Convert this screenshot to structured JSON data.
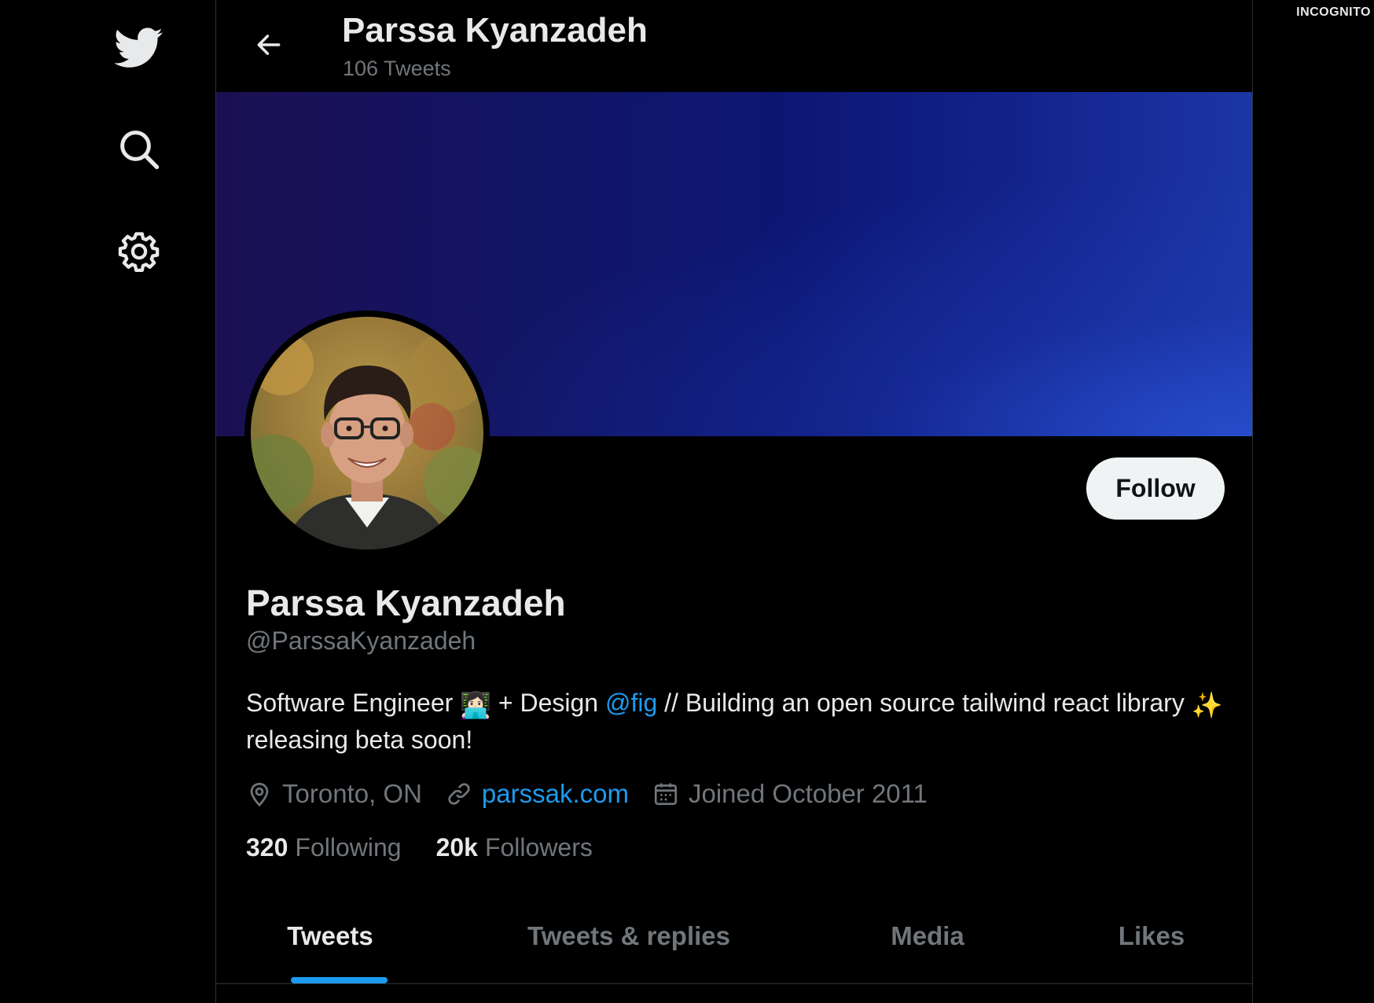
{
  "nav": {
    "items": [
      {
        "icon": "twitter-bird-icon"
      },
      {
        "icon": "search-icon"
      },
      {
        "icon": "gear-icon"
      }
    ]
  },
  "header": {
    "name": "Parssa Kyanzadeh",
    "tweet_count": "106 Tweets"
  },
  "profile": {
    "name": "Parssa Kyanzadeh",
    "handle": "@ParssaKyanzadeh",
    "follow_label": "Follow",
    "bio": {
      "part1": "Software Engineer ",
      "emoji1": "👩🏻‍💻",
      "part2": " + Design ",
      "mention": "@fig",
      "part3": " // Building an open source tailwind react library ",
      "emoji2": "✨",
      "part4": " releasing beta soon!"
    },
    "location": "Toronto, ON",
    "website": "parssak.com",
    "joined": "Joined October 2011",
    "following_count": "320",
    "following_label": "Following",
    "followers_count": "20k",
    "followers_label": "Followers"
  },
  "tabs": [
    {
      "label": "Tweets",
      "active": true
    },
    {
      "label": "Tweets & replies",
      "active": false
    },
    {
      "label": "Media",
      "active": false
    },
    {
      "label": "Likes",
      "active": false
    }
  ],
  "badge": "INCOGNITO",
  "colors": {
    "accent": "#1d9bf0",
    "background": "#000000",
    "text_primary": "#e7e9ea",
    "text_secondary": "#71767b",
    "follow_bg": "#eff3f4"
  }
}
